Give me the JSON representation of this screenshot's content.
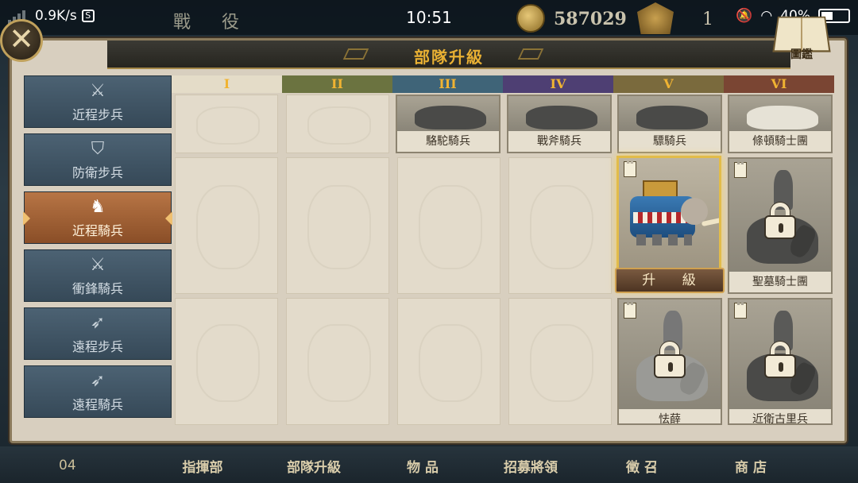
{
  "status_bar": {
    "speed": "0.9K/s",
    "time": "10:51",
    "battery": "40%"
  },
  "top_bar": {
    "campaign": "戰 役",
    "gold": "587029",
    "rank": "1"
  },
  "panel": {
    "title": "部隊升級",
    "codex_label": "圖鑑"
  },
  "sidebar": [
    {
      "icon": "⚔",
      "label": "近程步兵"
    },
    {
      "icon": "⛉",
      "label": "防衛步兵"
    },
    {
      "icon": "♞",
      "label": "近程騎兵"
    },
    {
      "icon": "⚔",
      "label": "衝鋒騎兵"
    },
    {
      "icon": "➶",
      "label": "遠程步兵"
    },
    {
      "icon": "➶",
      "label": "遠程騎兵"
    }
  ],
  "tiers": [
    "I",
    "II",
    "III",
    "IV",
    "V",
    "VI"
  ],
  "tier_colors": [
    "#e4dcc8",
    "#6b7340",
    "#3f6478",
    "#4e3f73",
    "#7a6a3d",
    "#7a4533"
  ],
  "units": {
    "row1": [
      "駱駝騎兵",
      "戰斧騎兵",
      "驃騎兵",
      "條頓騎士團"
    ],
    "row2": [
      "聖墓騎士團"
    ],
    "row3": [
      "怯薛",
      "近衛古里兵"
    ]
  },
  "upgrade_button": "升 級",
  "bottom_nav": {
    "page_number": "04",
    "items": [
      "指揮部",
      "部隊升級",
      "物 品",
      "招募將領",
      "徵 召",
      "商 店"
    ]
  }
}
